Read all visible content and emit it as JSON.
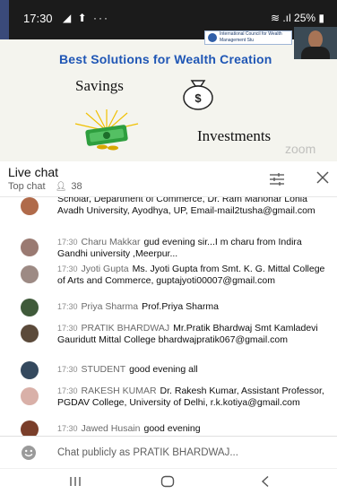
{
  "status_bar": {
    "time": "17:30",
    "notif_icons": "◢ ⬆ ···",
    "battery": "25%"
  },
  "video": {
    "org_logo_text": "International Council for Wealth Management Stu",
    "slide_title": "Best Solutions for Wealth Creation",
    "savings_label": "Savings",
    "investments_label": "Investments",
    "watermark": "zoom"
  },
  "chat": {
    "title": "Live chat",
    "mode": "Top chat",
    "viewer_icon": "person-icon",
    "viewer_count": "38",
    "messages": [
      {
        "time": "",
        "author": "",
        "text": "Scholar, Department of Commerce, Dr. Ram Manohar Lohia Avadh University, Ayodhya, UP, Email-mail2tusha@gmail.com",
        "avatar_color": "#b06a4a"
      },
      {
        "time": "17:30",
        "author": "Charu Makkar",
        "text": "gud evening sir...I m charu from Indira Gandhi university ,Meerpur...",
        "avatar_color": "#9a7a72"
      },
      {
        "time": "17:30",
        "author": "Jyoti Gupta",
        "text": "Ms. Jyoti Gupta from Smt. K. G. Mittal College of Arts and Commerce, guptajyoti00007@gmail.com",
        "avatar_color": "#9d8a84"
      },
      {
        "time": "17:30",
        "author": "Priya Sharma",
        "text": "Prof.Priya Sharma",
        "avatar_color": "#3f5a3a"
      },
      {
        "time": "17:30",
        "author": "PRATIK BHARDWAJ",
        "text": "Mr.Pratik Bhardwaj Smt Kamladevi Gauridutt Mittal College bhardwajpratik067@gmail.com",
        "avatar_color": "#5b4a3a"
      },
      {
        "time": "17:30",
        "author": "STUDENT",
        "text": "good evening all",
        "avatar_color": "#34495e"
      },
      {
        "time": "17:30",
        "author": "RAKESH KUMAR",
        "text": "Dr. Rakesh Kumar, Assistant Professor, PGDAV College, University of Delhi, r.k.kotiya@gmail.com",
        "avatar_color": "#d9b0a8"
      },
      {
        "time": "17:30",
        "author": "Jawed Husain",
        "text": "good evening",
        "avatar_color": "#7a3e2a"
      }
    ],
    "input_placeholder": "Chat publicly as PRATIK BHARDWAJ..."
  },
  "colors": {
    "slide_title": "#1f56b5",
    "timestamp": "#8a8a8a",
    "author": "#6a6a6a"
  },
  "icons": {
    "filter": "filter-icon",
    "close": "close-icon",
    "emoji": "smile-icon",
    "nav_recent": "recent-apps-icon",
    "nav_home": "home-icon",
    "nav_back": "back-icon"
  }
}
